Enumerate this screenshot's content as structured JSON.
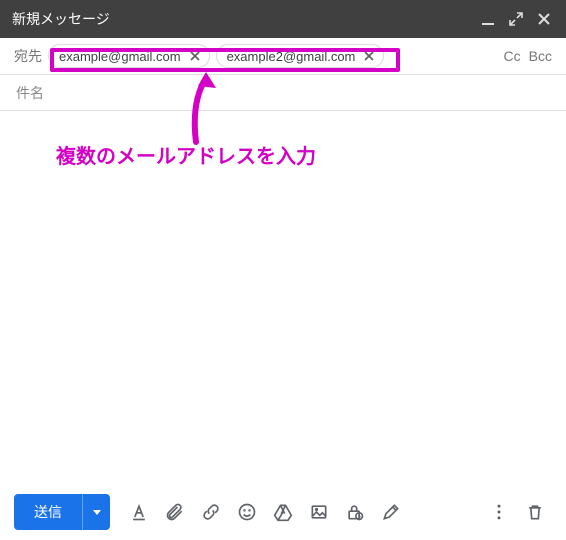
{
  "header": {
    "title": "新規メッセージ"
  },
  "to": {
    "label": "宛先",
    "chips": [
      {
        "email": "example@gmail.com"
      },
      {
        "email": "example2@gmail.com"
      }
    ],
    "cc_label": "Cc",
    "bcc_label": "Bcc"
  },
  "subject": {
    "placeholder": "件名"
  },
  "annotation": {
    "text": "複数のメールアドレスを入力"
  },
  "toolbar": {
    "send_label": "送信"
  }
}
